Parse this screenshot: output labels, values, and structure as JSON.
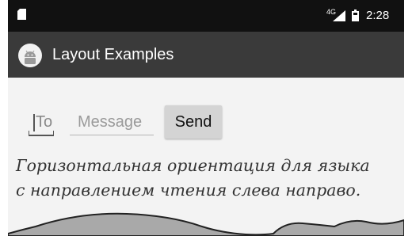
{
  "status_bar": {
    "network": "4G",
    "time": "2:28",
    "icons": [
      "sd-card-icon",
      "signal-icon",
      "battery-icon"
    ]
  },
  "action_bar": {
    "title": "Layout Examples",
    "icon": "android-icon"
  },
  "form": {
    "to_placeholder": "To",
    "message_placeholder": "Message",
    "send_label": "Send"
  },
  "caption": {
    "line1": "Горизонтальная ориентация для языка",
    "line2": "с направлением чтения слева направо."
  },
  "colors": {
    "status_bar": "#111111",
    "action_bar": "#3a3a3a",
    "background": "#f3f3f3",
    "send_button": "#d4d4d4",
    "hills": "#a9a9a9"
  }
}
